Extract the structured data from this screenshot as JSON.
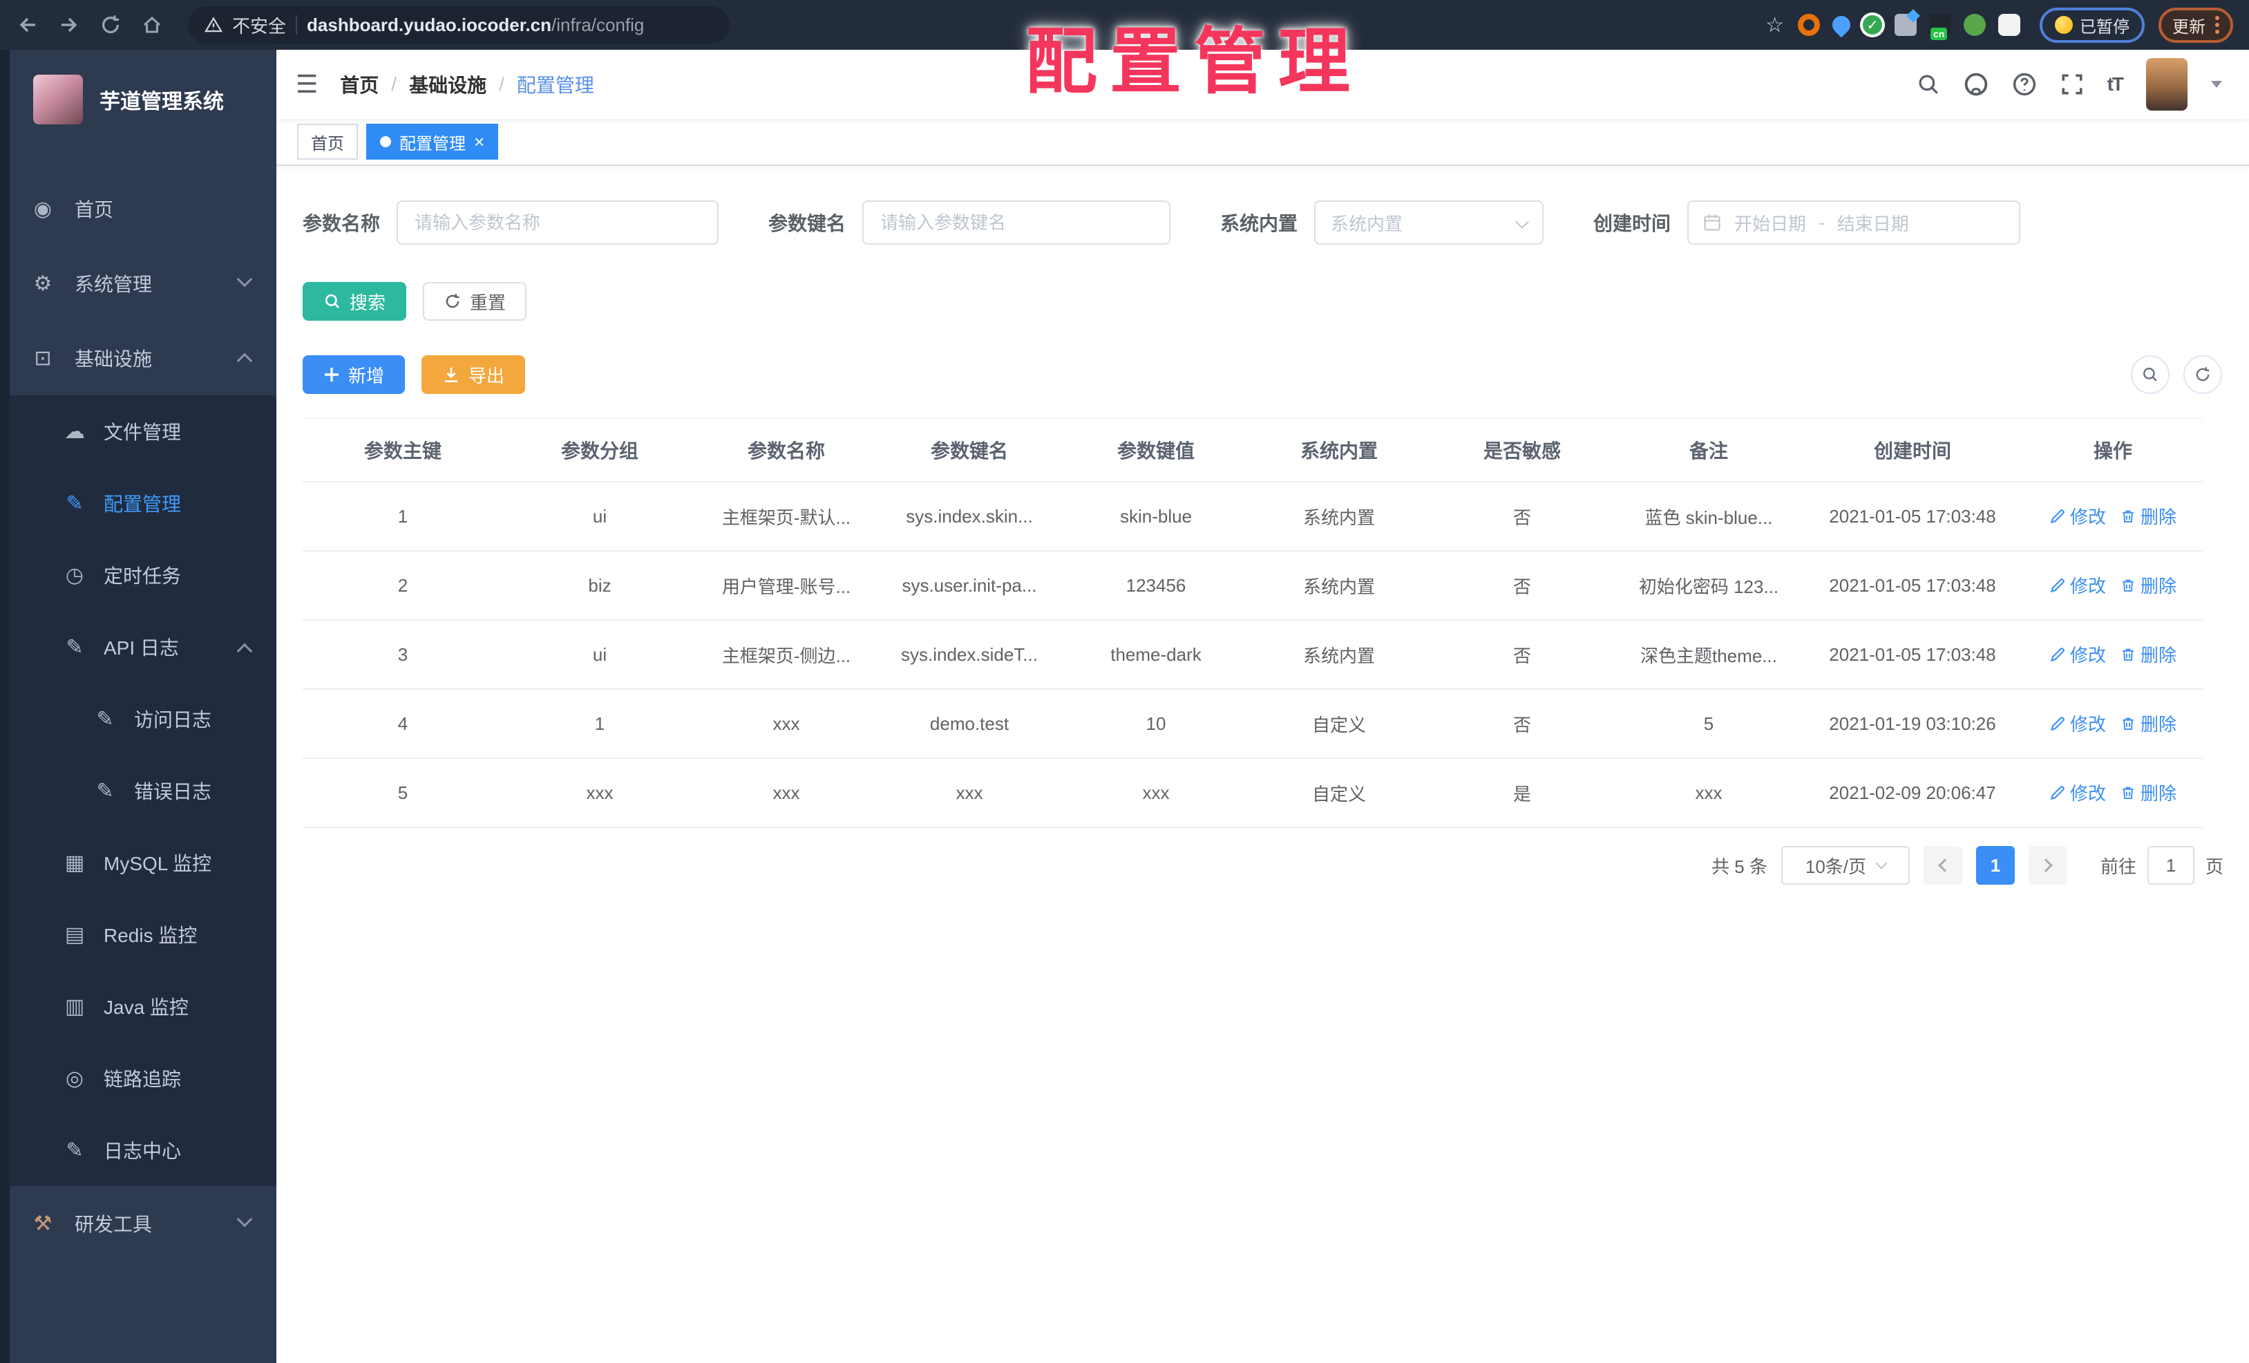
{
  "browser": {
    "security_label": "不安全",
    "url_domain": "dashboard.yudao.iocoder.cn",
    "url_path": "/infra/config",
    "ext_cn_label": "cn",
    "paused_badge": "已暂停",
    "update_label": "更新"
  },
  "annotation": {
    "text": "配置管理"
  },
  "sidebar": {
    "app_title": "芋道管理系统",
    "items": [
      {
        "id": "home",
        "label": "首页",
        "icon": "dashboard-icon",
        "glyph": "◉",
        "level": 0
      },
      {
        "id": "system",
        "label": "系统管理",
        "icon": "gear-icon",
        "glyph": "⚙",
        "level": 0,
        "chevron": "down"
      },
      {
        "id": "infra",
        "label": "基础设施",
        "icon": "monitor-chart-icon",
        "glyph": "⊡",
        "level": 0,
        "chevron": "up"
      },
      {
        "id": "file",
        "label": "文件管理",
        "icon": "cloud-upload-icon",
        "glyph": "☁",
        "level": 1
      },
      {
        "id": "config",
        "label": "配置管理",
        "icon": "edit-square-icon",
        "glyph": "✎",
        "level": 1,
        "active": true
      },
      {
        "id": "job",
        "label": "定时任务",
        "icon": "timer-icon",
        "glyph": "◷",
        "level": 1
      },
      {
        "id": "api-log",
        "label": "API 日志",
        "icon": "api-log-icon",
        "glyph": "✎",
        "level": 1,
        "chevron": "up"
      },
      {
        "id": "access-log",
        "label": "访问日志",
        "icon": "access-log-icon",
        "glyph": "✎",
        "level": 2
      },
      {
        "id": "error-log",
        "label": "错误日志",
        "icon": "error-log-icon",
        "glyph": "✎",
        "level": 2
      },
      {
        "id": "mysql",
        "label": "MySQL 监控",
        "icon": "mysql-monitor-icon",
        "glyph": "▦",
        "level": 1
      },
      {
        "id": "redis",
        "label": "Redis 监控",
        "icon": "redis-monitor-icon",
        "glyph": "▤",
        "level": 1
      },
      {
        "id": "java",
        "label": "Java 监控",
        "icon": "java-monitor-icon",
        "glyph": "▥",
        "level": 1
      },
      {
        "id": "trace",
        "label": "链路追踪",
        "icon": "eye-icon",
        "glyph": "◎",
        "level": 1
      },
      {
        "id": "log-center",
        "label": "日志中心",
        "icon": "log-center-icon",
        "glyph": "✎",
        "level": 1
      },
      {
        "id": "devtools",
        "label": "研发工具",
        "icon": "toolbox-icon",
        "glyph": "⚒",
        "level": 0,
        "chevron": "down",
        "tint": "#c59a72"
      }
    ]
  },
  "breadcrumb": {
    "separator": "/",
    "items": [
      "首页",
      "基础设施",
      "配置管理"
    ]
  },
  "tabs": [
    {
      "label": "首页",
      "active": false
    },
    {
      "label": "配置管理",
      "active": true
    }
  ],
  "filters": {
    "name": {
      "label": "参数名称",
      "placeholder": "请输入参数名称"
    },
    "key": {
      "label": "参数键名",
      "placeholder": "请输入参数键名"
    },
    "builtin": {
      "label": "系统内置",
      "placeholder": "系统内置"
    },
    "created": {
      "label": "创建时间",
      "start_placeholder": "开始日期",
      "separator": "-",
      "end_placeholder": "结束日期"
    }
  },
  "toolbar": {
    "search": "搜索",
    "reset": "重置",
    "add": "新增",
    "export": "导出"
  },
  "table": {
    "headers": [
      "参数主键",
      "参数分组",
      "参数名称",
      "参数键名",
      "参数键值",
      "系统内置",
      "是否敏感",
      "备注",
      "创建时间",
      "操作"
    ],
    "rows": [
      [
        "1",
        "ui",
        "主框架页-默认...",
        "sys.index.skin...",
        "skin-blue",
        "系统内置",
        "否",
        "蓝色 skin-blue...",
        "2021-01-05 17:03:48"
      ],
      [
        "2",
        "biz",
        "用户管理-账号...",
        "sys.user.init-pa...",
        "123456",
        "系统内置",
        "否",
        "初始化密码 123...",
        "2021-01-05 17:03:48"
      ],
      [
        "3",
        "ui",
        "主框架页-侧边...",
        "sys.index.sideT...",
        "theme-dark",
        "系统内置",
        "否",
        "深色主题theme...",
        "2021-01-05 17:03:48"
      ],
      [
        "4",
        "1",
        "xxx",
        "demo.test",
        "10",
        "自定义",
        "否",
        "5",
        "2021-01-19 03:10:26"
      ],
      [
        "5",
        "xxx",
        "xxx",
        "xxx",
        "xxx",
        "自定义",
        "是",
        "xxx",
        "2021-02-09 20:06:47"
      ]
    ],
    "row_actions": {
      "edit": "修改",
      "delete": "删除"
    }
  },
  "pagination": {
    "total": "共 5 条",
    "page_size": "10条/页",
    "current_page": "1",
    "goto_label": "前往",
    "goto_value": "1",
    "page_unit": "页"
  },
  "colors": {
    "accent": "#3a8ef6",
    "success": "#2cb9a0",
    "warning": "#f3a73d",
    "sidebar": "#2d3a50",
    "submenu": "#202b3e",
    "annotation": "#f5365c"
  }
}
